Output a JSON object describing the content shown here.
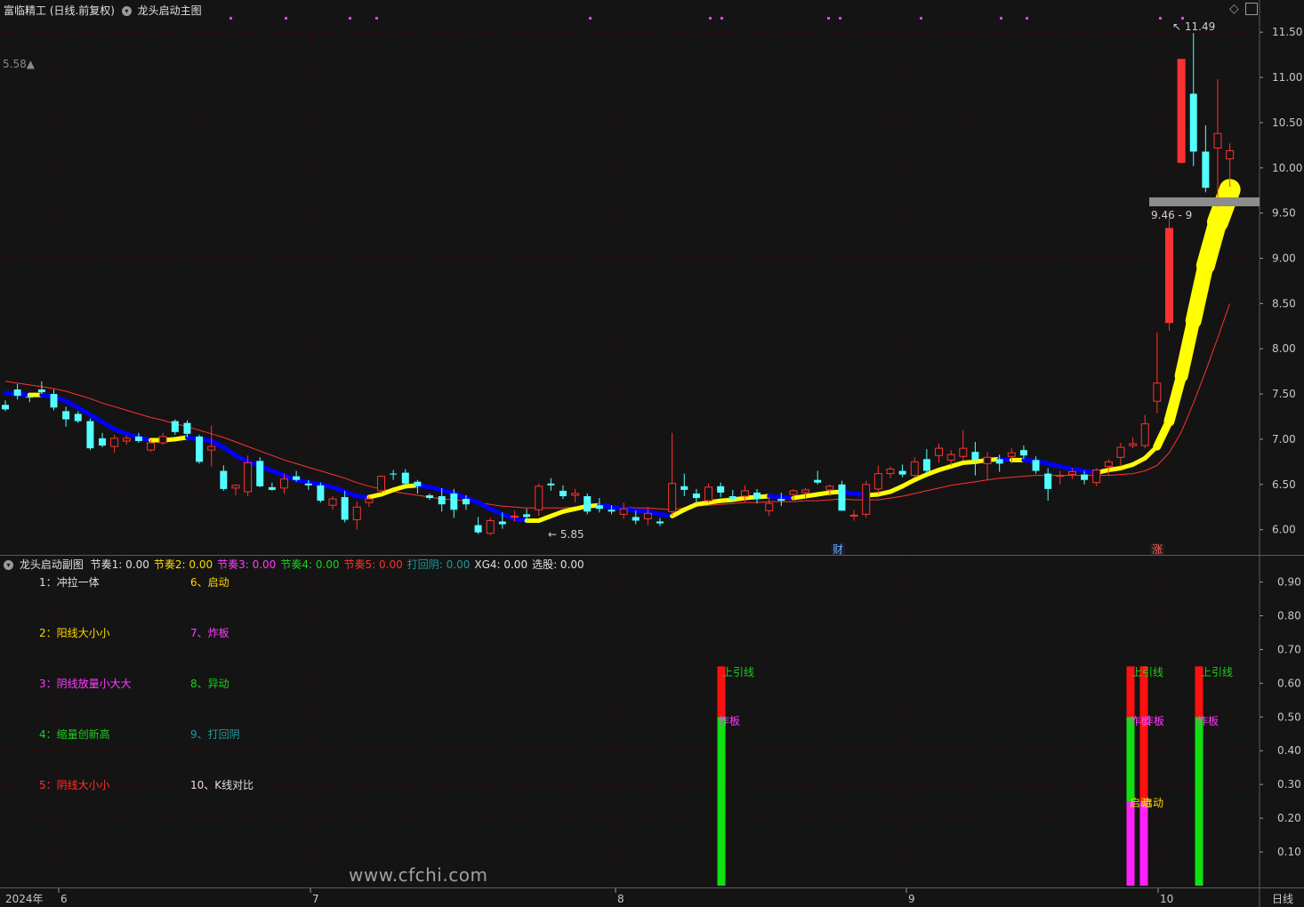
{
  "main_panel": {
    "stock_title": "富临精工 (日线.前复权)",
    "indicator_name": "龙头启动主图",
    "prev_mark": "5.58▲",
    "high_label": "11.49",
    "low_label": "5.85",
    "band_label": "9.46 - 9",
    "event_badge_1": "财",
    "event_badge_2": "涨"
  },
  "sub_panel": {
    "indicator_name": "龙头启动副图",
    "values": [
      {
        "label": "节奏1: 0.00",
        "color": "#e0e0e0"
      },
      {
        "label": "节奏2: 0.00",
        "color": "#ffd700"
      },
      {
        "label": "节奏3: 0.00",
        "color": "#ff3cff"
      },
      {
        "label": "节奏4: 0.00",
        "color": "#19d219"
      },
      {
        "label": "节奏5: 0.00",
        "color": "#ff3030"
      },
      {
        "label": "打回阴: 0.00",
        "color": "#1f9a9a"
      },
      {
        "label": "XG4: 0.00",
        "color": "#e0e0e0"
      },
      {
        "label": "选股: 0.00",
        "color": "#e0e0e0"
      }
    ],
    "legend_left": [
      {
        "label": "1：冲拉一体",
        "color": "#e0e0e0"
      },
      {
        "label": "2：阳线大小小",
        "color": "#ffd700"
      },
      {
        "label": "3：阴线放量小大大",
        "color": "#ff3cff"
      },
      {
        "label": "4：缩量创新高",
        "color": "#19d219"
      },
      {
        "label": "5：阴线大小小",
        "color": "#ff3030"
      }
    ],
    "legend_right": [
      {
        "label": "6、启动",
        "color": "#ffd700"
      },
      {
        "label": "7、炸板",
        "color": "#ff3cff"
      },
      {
        "label": "8、异动",
        "color": "#19d219"
      },
      {
        "label": "9、打回阴",
        "color": "#1f9a9a"
      },
      {
        "label": "10、K线对比",
        "color": "#e0e0e0"
      }
    ],
    "bar_labels": {
      "upper_shadow": "上引线",
      "zhaban": "炸板",
      "qidong": "启动"
    },
    "signal_bars": [
      {
        "date": "2024-08-22",
        "green": 0.5,
        "red": 0.65
      },
      {
        "date": "2024-09-30",
        "magenta": 0.25,
        "green": 0.5,
        "red": 0.65
      },
      {
        "date": "2024-10-08",
        "magenta": 0.25,
        "red": 0.65
      },
      {
        "date": "2024-10-11",
        "green": 0.5,
        "red": 0.65
      }
    ]
  },
  "price_axis": [
    "11.50",
    "11.00",
    "10.50",
    "10.00",
    "9.50",
    "9.00",
    "8.50",
    "8.00",
    "7.50",
    "7.00",
    "6.50",
    "6.00"
  ],
  "sub_axis": [
    "0.90",
    "0.80",
    "0.70",
    "0.60",
    "0.50",
    "0.40",
    "0.30",
    "0.20",
    "0.10"
  ],
  "x_axis": {
    "year": "2024年",
    "months": [
      "6",
      "7",
      "8",
      "9",
      "10"
    ]
  },
  "timeframe": "日线",
  "watermark": "www.cfchi.com",
  "colors": {
    "up": "#ff3232",
    "down": "#54ffff",
    "ma_fast_up": "#ffff00",
    "ma_fast_down": "#0000ff",
    "ma_slow": "#ff3232",
    "grid": "#3a0000"
  },
  "chart_data": {
    "type": "candlestick",
    "ohlc_estimated": [
      [
        7.38,
        7.43,
        7.31,
        7.33
      ],
      [
        7.55,
        7.61,
        7.44,
        7.48
      ],
      [
        7.47,
        7.5,
        7.41,
        7.46
      ],
      [
        7.55,
        7.64,
        7.5,
        7.52
      ],
      [
        7.5,
        7.55,
        7.32,
        7.35
      ],
      [
        7.31,
        7.36,
        7.14,
        7.22
      ],
      [
        7.28,
        7.31,
        7.18,
        7.2
      ],
      [
        7.2,
        7.23,
        6.88,
        6.9
      ],
      [
        7.01,
        7.07,
        6.91,
        6.93
      ],
      [
        6.92,
        7.05,
        6.85,
        7.01
      ],
      [
        6.98,
        7.04,
        6.94,
        7.01
      ],
      [
        7.03,
        7.07,
        6.96,
        6.98
      ],
      [
        6.88,
        7.0,
        6.86,
        6.96
      ],
      [
        6.96,
        7.07,
        6.94,
        7.03
      ],
      [
        7.2,
        7.22,
        7.05,
        7.08
      ],
      [
        7.18,
        7.21,
        7.02,
        7.06
      ],
      [
        7.03,
        7.05,
        6.73,
        6.75
      ],
      [
        6.88,
        7.15,
        6.7,
        6.92
      ],
      [
        6.65,
        6.71,
        6.43,
        6.45
      ],
      [
        6.46,
        6.5,
        6.38,
        6.49
      ],
      [
        6.42,
        6.82,
        6.37,
        6.74
      ],
      [
        6.76,
        6.8,
        6.47,
        6.48
      ],
      [
        6.47,
        6.52,
        6.43,
        6.44
      ],
      [
        6.46,
        6.62,
        6.4,
        6.56
      ],
      [
        6.59,
        6.65,
        6.53,
        6.55
      ],
      [
        6.51,
        6.55,
        6.44,
        6.49
      ],
      [
        6.49,
        6.52,
        6.3,
        6.32
      ],
      [
        6.27,
        6.37,
        6.22,
        6.34
      ],
      [
        6.36,
        6.43,
        6.08,
        6.11
      ],
      [
        6.11,
        6.31,
        6.0,
        6.25
      ],
      [
        6.3,
        6.37,
        6.25,
        6.34
      ],
      [
        6.43,
        6.6,
        6.4,
        6.59
      ],
      [
        6.62,
        6.66,
        6.55,
        6.61
      ],
      [
        6.63,
        6.67,
        6.49,
        6.51
      ],
      [
        6.53,
        6.55,
        6.4,
        6.48
      ],
      [
        6.38,
        6.4,
        6.33,
        6.35
      ],
      [
        6.37,
        6.46,
        6.2,
        6.28
      ],
      [
        6.4,
        6.45,
        6.13,
        6.22
      ],
      [
        6.34,
        6.38,
        6.22,
        6.28
      ],
      [
        6.05,
        6.14,
        5.95,
        5.97
      ],
      [
        5.96,
        6.13,
        5.94,
        6.1
      ],
      [
        6.09,
        6.19,
        6.01,
        6.06
      ],
      [
        6.15,
        6.21,
        6.09,
        6.15
      ],
      [
        6.17,
        6.23,
        6.09,
        6.14
      ],
      [
        6.22,
        6.51,
        6.15,
        6.48
      ],
      [
        6.51,
        6.57,
        6.43,
        6.49
      ],
      [
        6.43,
        6.49,
        6.34,
        6.37
      ],
      [
        6.38,
        6.45,
        6.3,
        6.4
      ],
      [
        6.37,
        6.4,
        6.17,
        6.2
      ],
      [
        6.27,
        6.35,
        6.19,
        6.23
      ],
      [
        6.22,
        6.27,
        6.17,
        6.2
      ],
      [
        6.17,
        6.3,
        6.12,
        6.23
      ],
      [
        6.14,
        6.21,
        6.06,
        6.1
      ],
      [
        6.12,
        6.25,
        6.05,
        6.18
      ],
      [
        6.09,
        6.13,
        6.04,
        6.07
      ],
      [
        6.2,
        7.07,
        6.15,
        6.51
      ],
      [
        6.48,
        6.62,
        6.37,
        6.44
      ],
      [
        6.4,
        6.45,
        6.28,
        6.35
      ],
      [
        6.32,
        6.51,
        6.3,
        6.47
      ],
      [
        6.48,
        6.52,
        6.36,
        6.41
      ],
      [
        6.37,
        6.44,
        6.31,
        6.34
      ],
      [
        6.37,
        6.49,
        6.3,
        6.43
      ],
      [
        6.41,
        6.45,
        6.29,
        6.34
      ],
      [
        6.21,
        6.36,
        6.15,
        6.29
      ],
      [
        6.34,
        6.41,
        6.26,
        6.32
      ],
      [
        6.39,
        6.45,
        6.33,
        6.43
      ],
      [
        6.41,
        6.46,
        6.34,
        6.44
      ],
      [
        6.55,
        6.65,
        6.5,
        6.52
      ],
      [
        6.44,
        6.5,
        6.37,
        6.48
      ],
      [
        6.5,
        6.54,
        6.21,
        6.21
      ],
      [
        6.15,
        6.22,
        6.1,
        6.16
      ],
      [
        6.17,
        6.54,
        6.13,
        6.5
      ],
      [
        6.45,
        6.71,
        6.4,
        6.62
      ],
      [
        6.62,
        6.7,
        6.57,
        6.67
      ],
      [
        6.65,
        6.72,
        6.58,
        6.61
      ],
      [
        6.6,
        6.8,
        6.58,
        6.75
      ],
      [
        6.78,
        6.89,
        6.62,
        6.65
      ],
      [
        6.82,
        6.95,
        6.74,
        6.9
      ],
      [
        6.77,
        6.88,
        6.71,
        6.83
      ],
      [
        6.81,
        7.1,
        6.77,
        6.9
      ],
      [
        6.86,
        6.97,
        6.6,
        6.77
      ],
      [
        6.73,
        6.86,
        6.55,
        6.8
      ],
      [
        6.78,
        6.83,
        6.64,
        6.73
      ],
      [
        6.81,
        6.9,
        6.73,
        6.85
      ],
      [
        6.88,
        6.93,
        6.78,
        6.82
      ],
      [
        6.77,
        6.81,
        6.62,
        6.65
      ],
      [
        6.62,
        6.68,
        6.32,
        6.45
      ],
      [
        6.59,
        6.65,
        6.5,
        6.6
      ],
      [
        6.61,
        6.68,
        6.56,
        6.64
      ],
      [
        6.61,
        6.65,
        6.5,
        6.55
      ],
      [
        6.52,
        6.68,
        6.48,
        6.66
      ],
      [
        6.7,
        6.78,
        6.6,
        6.75
      ],
      [
        6.8,
        6.96,
        6.7,
        6.91
      ],
      [
        6.93,
        7.02,
        6.9,
        6.95
      ],
      [
        6.93,
        7.27,
        6.9,
        7.17
      ],
      [
        7.42,
        8.18,
        7.29,
        7.62
      ],
      [
        8.29,
        9.44,
        8.2,
        9.33
      ],
      [
        10.06,
        11.2,
        10.05,
        11.2
      ],
      [
        10.82,
        11.49,
        10.02,
        10.18
      ],
      [
        10.18,
        10.47,
        9.73,
        9.78
      ],
      [
        10.22,
        10.98,
        9.57,
        10.38
      ],
      [
        10.1,
        10.27,
        9.79,
        10.19
      ]
    ],
    "ma_fast_estimated": [
      7.51,
      7.5,
      7.49,
      7.49,
      7.47,
      7.42,
      7.35,
      7.27,
      7.19,
      7.11,
      7.06,
      7.02,
      6.99,
      6.99,
      7.0,
      7.02,
      7.0,
      6.98,
      6.91,
      6.82,
      6.75,
      6.71,
      6.65,
      6.6,
      6.55,
      6.52,
      6.5,
      6.47,
      6.42,
      6.37,
      6.36,
      6.39,
      6.44,
      6.48,
      6.49,
      6.47,
      6.44,
      6.4,
      6.35,
      6.3,
      6.23,
      6.17,
      6.12,
      6.1,
      6.1,
      6.15,
      6.2,
      6.23,
      6.26,
      6.27,
      6.25,
      6.23,
      6.21,
      6.2,
      6.17,
      6.15,
      6.22,
      6.28,
      6.3,
      6.32,
      6.33,
      6.35,
      6.36,
      6.37,
      6.36,
      6.35,
      6.37,
      6.39,
      6.41,
      6.42,
      6.4,
      6.38,
      6.39,
      6.42,
      6.48,
      6.55,
      6.61,
      6.66,
      6.7,
      6.74,
      6.75,
      6.77,
      6.78,
      6.77,
      6.77,
      6.76,
      6.73,
      6.7,
      6.67,
      6.65,
      6.63,
      6.66,
      6.68,
      6.72,
      6.79,
      6.92,
      7.2,
      7.7,
      8.31,
      8.92,
      9.4,
      9.76
    ],
    "ma_slow_estimated": [
      7.64,
      7.62,
      7.6,
      7.58,
      7.56,
      7.53,
      7.49,
      7.45,
      7.4,
      7.36,
      7.32,
      7.28,
      7.24,
      7.21,
      7.17,
      7.14,
      7.1,
      7.06,
      7.02,
      6.97,
      6.92,
      6.87,
      6.82,
      6.77,
      6.73,
      6.69,
      6.65,
      6.61,
      6.57,
      6.52,
      6.48,
      6.45,
      6.42,
      6.4,
      6.38,
      6.36,
      6.34,
      6.33,
      6.32,
      6.3,
      6.28,
      6.26,
      6.25,
      6.24,
      6.24,
      6.24,
      6.24,
      6.25,
      6.26,
      6.26,
      6.26,
      6.25,
      6.24,
      6.24,
      6.23,
      6.22,
      6.24,
      6.26,
      6.27,
      6.28,
      6.29,
      6.3,
      6.3,
      6.31,
      6.31,
      6.31,
      6.32,
      6.32,
      6.33,
      6.34,
      6.33,
      6.33,
      6.33,
      6.35,
      6.37,
      6.4,
      6.43,
      6.46,
      6.49,
      6.51,
      6.53,
      6.55,
      6.57,
      6.58,
      6.59,
      6.6,
      6.6,
      6.6,
      6.6,
      6.6,
      6.6,
      6.6,
      6.61,
      6.62,
      6.65,
      6.71,
      6.85,
      7.08,
      7.4,
      7.75,
      8.12,
      8.5
    ],
    "ylim": [
      5.8,
      11.62
    ]
  }
}
